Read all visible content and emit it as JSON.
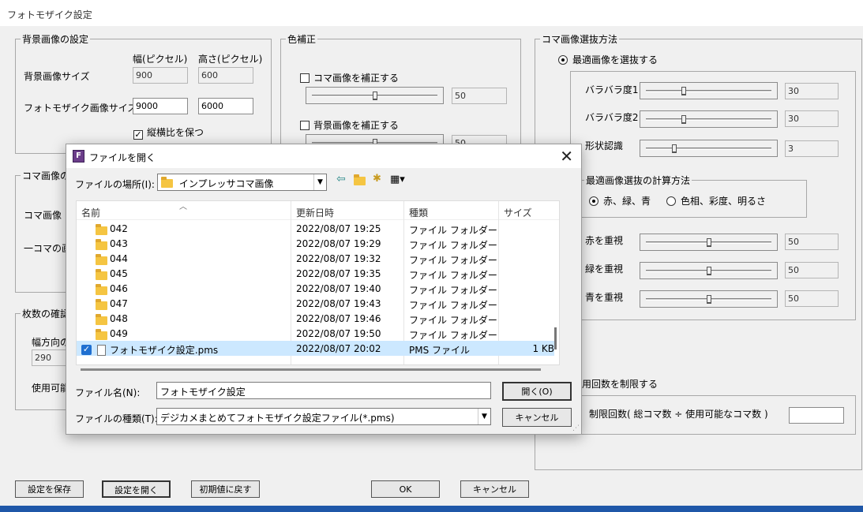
{
  "window": {
    "title": "フォトモザイク設定"
  },
  "bg_group": {
    "legend": "背景画像の設定",
    "col_width": "幅(ピクセル)",
    "col_height": "高さ(ピクセル)",
    "bg_size_label": "背景画像サイズ",
    "bg_w": "900",
    "bg_h": "600",
    "mosaic_size_label": "フォトモザイク画像サイズ",
    "mosaic_w": "9000",
    "mosaic_h": "6000",
    "keep_ratio_label": "縦横比を保つ",
    "keep_ratio_checked": true
  },
  "koma_group": {
    "legend": "コマ画像の",
    "size_label": "コマ画像",
    "one_label": "一コマの画"
  },
  "count_group": {
    "legend": "枚数の確認",
    "width_label": "幅方向の",
    "width_value": "290",
    "usable_label": "使用可能"
  },
  "color_group": {
    "legend": "色補正",
    "koma_label": "コマ画像を補正する",
    "koma_value": "50",
    "koma_level": 0.5,
    "bg_label": "背景画像を補正する",
    "bg_value": "50"
  },
  "select_group": {
    "legend": "コマ画像選抜方法",
    "best_label": "最適画像を選抜する",
    "rows": [
      {
        "label": "バラバラ度1",
        "value": "30"
      },
      {
        "label": "バラバラ度2",
        "value": "30"
      },
      {
        "label": "形状認識",
        "value": "3"
      }
    ],
    "calc_legend": "最適画像選抜の計算方法",
    "rgb_label": "赤、緑、青",
    "hsv_label": "色相、彩度、明るさ",
    "weights": [
      {
        "label": "赤を重視",
        "value": "50"
      },
      {
        "label": "緑を重視",
        "value": "50"
      },
      {
        "label": "青を重視",
        "value": "50"
      }
    ],
    "limit_label": "用回数を制限する",
    "limit_formula": "制限回数( 総コマ数 ÷ 使用可能なコマ数 )",
    "limit_value": ""
  },
  "bottom_buttons": {
    "save": "設定を保存",
    "open": "設定を開く",
    "reset": "初期値に戻す",
    "ok": "OK",
    "cancel": "キャンセル"
  },
  "dialog": {
    "icon_letter": "F",
    "title": "ファイルを開く",
    "location_label": "ファイルの場所(I):",
    "location_value": "インプレッサコマ画像",
    "columns": {
      "name": "名前",
      "date": "更新日時",
      "type": "種類",
      "size": "サイズ"
    },
    "files": [
      {
        "name": "042",
        "date": "2022/08/07 19:25",
        "type": "ファイル フォルダー",
        "size": "",
        "kind": "folder"
      },
      {
        "name": "043",
        "date": "2022/08/07 19:29",
        "type": "ファイル フォルダー",
        "size": "",
        "kind": "folder"
      },
      {
        "name": "044",
        "date": "2022/08/07 19:32",
        "type": "ファイル フォルダー",
        "size": "",
        "kind": "folder"
      },
      {
        "name": "045",
        "date": "2022/08/07 19:35",
        "type": "ファイル フォルダー",
        "size": "",
        "kind": "folder"
      },
      {
        "name": "046",
        "date": "2022/08/07 19:40",
        "type": "ファイル フォルダー",
        "size": "",
        "kind": "folder"
      },
      {
        "name": "047",
        "date": "2022/08/07 19:43",
        "type": "ファイル フォルダー",
        "size": "",
        "kind": "folder"
      },
      {
        "name": "048",
        "date": "2022/08/07 19:46",
        "type": "ファイル フォルダー",
        "size": "",
        "kind": "folder"
      },
      {
        "name": "049",
        "date": "2022/08/07 19:50",
        "type": "ファイル フォルダー",
        "size": "",
        "kind": "folder"
      },
      {
        "name": "フォトモザイク設定.pms",
        "date": "2022/08/07 20:02",
        "type": "PMS ファイル",
        "size": "1 KB",
        "kind": "file",
        "selected": true
      }
    ],
    "filename_label": "ファイル名(N):",
    "filename_value": "フォトモザイク設定",
    "filetype_label": "ファイルの種類(T):",
    "filetype_value": "デジカメまとめてフォトモザイク設定ファイル(*.pms)",
    "open_button": "開く(O)",
    "cancel_button": "キャンセル"
  }
}
